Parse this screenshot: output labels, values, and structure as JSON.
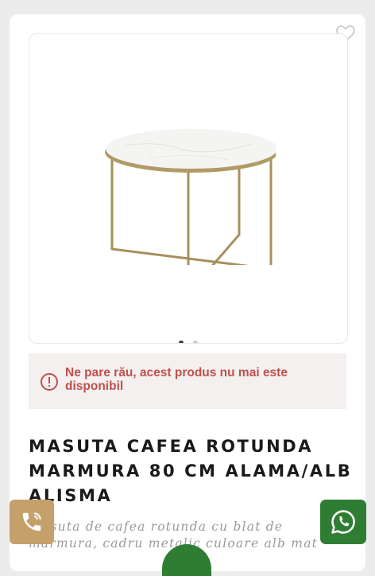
{
  "product": {
    "alert_message": "Ne pare rău, acest produs nu mai este disponibil",
    "title": "MASUTA CAFEA ROTUNDA MARMURA 80 CM ALAMA/ALB ALISMA",
    "description": "Masuta de cafea rotunda cu blat de marmura, cadru metalic culoare alb mat"
  },
  "gallery": {
    "current_slide": 1,
    "slides_total": 2
  },
  "icons": {
    "wishlist": "heart-outline-icon",
    "alert": "exclamation-circle-icon",
    "phone": "phone-call-icon",
    "whatsapp": "whatsapp-icon"
  },
  "colors": {
    "alert_red": "#c0504d",
    "accent_gold": "#c4a06a",
    "whatsapp_green": "#2e7d32"
  }
}
